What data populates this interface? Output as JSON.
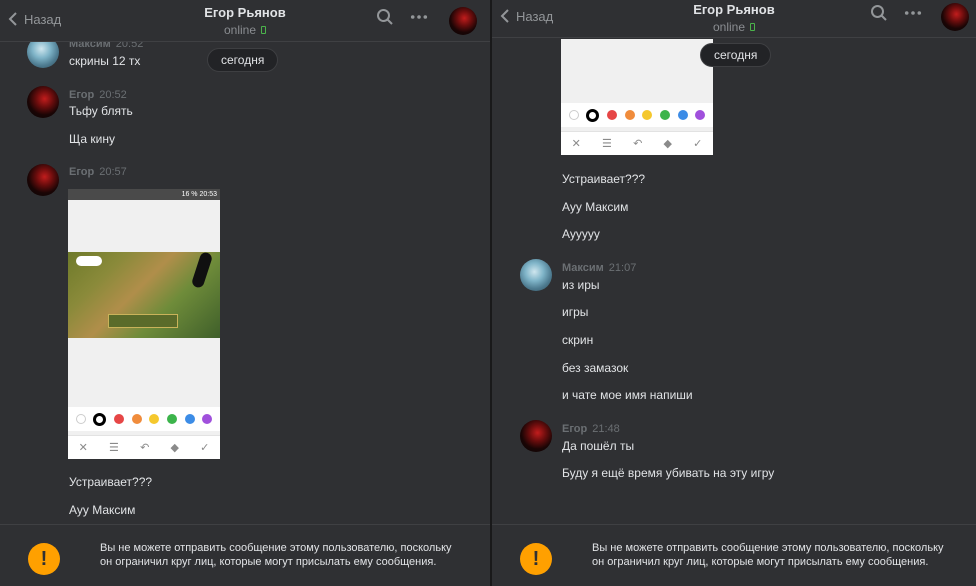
{
  "header": {
    "back_label": "Назад",
    "contact_name": "Егор Рьянов",
    "status": "online"
  },
  "date_label": "сегодня",
  "notice": "Вы не можете отправить сообщение этому пользователю, поскольку он ограничил круг лиц, которые могут присылать ему сообщения.",
  "left": {
    "messages": [
      {
        "author": "Максим",
        "time": "20:52",
        "lines": [
          "скрины 12 тх"
        ]
      },
      {
        "author": "Егор",
        "time": "20:52",
        "lines": [
          "Тьфу блять",
          "Ща кину"
        ]
      },
      {
        "author": "Егор",
        "time": "20:57",
        "lines": [
          "Устраивает???",
          "Ауу Максим"
        ]
      }
    ],
    "screenshot_status": "16 % 20:53"
  },
  "right": {
    "lines_top": [
      "Устраивает???",
      "Ауу Максим",
      "Аууууу"
    ],
    "messages": [
      {
        "author": "Максим",
        "time": "21:07",
        "lines": [
          "из иры",
          "игры",
          "скрин",
          "без замазок",
          "и чате мое имя напиши"
        ]
      },
      {
        "author": "Егор",
        "time": "21:48",
        "lines": [
          "Да пошёл ты",
          "Буду я ещё время убивать на эту игру"
        ]
      }
    ]
  },
  "palette": [
    "#ffffff",
    "#000000",
    "#e64646",
    "#f08c3c",
    "#f5c82d",
    "#3cb44b",
    "#3c8ce6",
    "#a050dc"
  ],
  "colors": {
    "background": "#2f3033",
    "accent_warning": "#ffa000",
    "online": "#4bb34b"
  },
  "icons": [
    "back-chevron-icon",
    "search-icon",
    "more-icon",
    "phone-icon",
    "warning-icon",
    "close-icon",
    "menu-icon",
    "undo-icon",
    "eraser-icon",
    "check-icon"
  ]
}
